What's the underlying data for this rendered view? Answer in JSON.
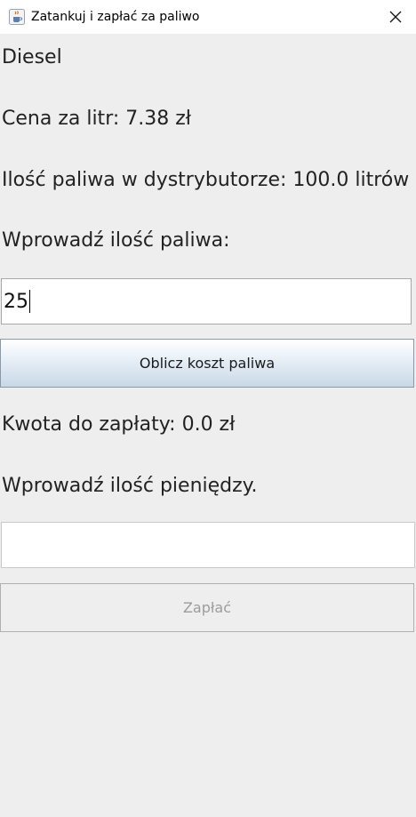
{
  "window": {
    "title": "Zatankuj i zapłać za paliwo"
  },
  "fuel": {
    "type": "Diesel",
    "price_label": "Cena za litr: 7.38 zł",
    "stock_label": "Ilość paliwa w dystrybutorze: 100.0 litrów",
    "amount_prompt": "Wprowadź ilość paliwa:",
    "amount_value": "25"
  },
  "actions": {
    "calculate_label": "Oblicz koszt paliwa",
    "pay_label": "Zapłać"
  },
  "payment": {
    "due_label": "Kwota do zapłaty: 0.0 zł",
    "money_prompt": "Wprowadź ilość pieniędzy.",
    "money_value": ""
  },
  "colors": {
    "window_bg": "#eeeeee",
    "titlebar_bg": "#ffffff",
    "button_gradient_bottom": "#c9d8e7"
  }
}
